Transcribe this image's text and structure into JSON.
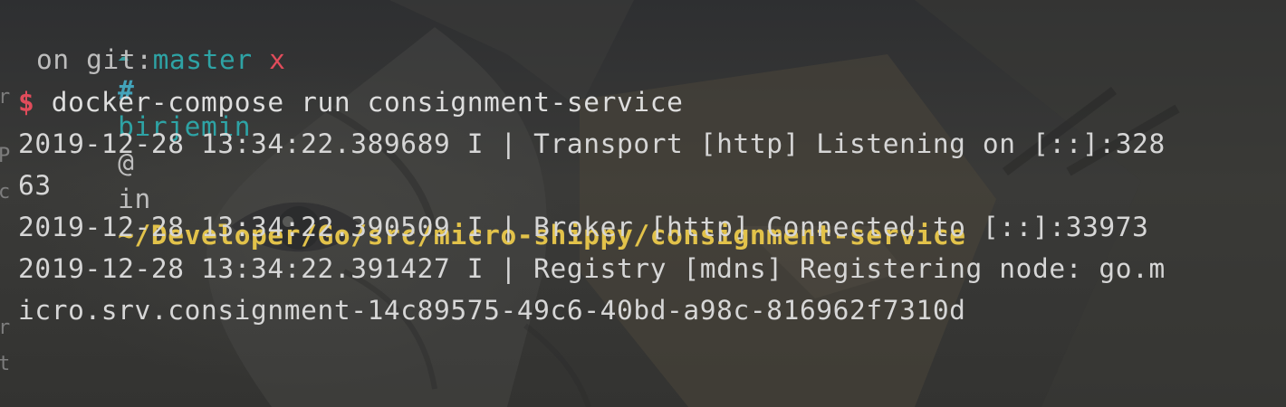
{
  "prompt": {
    "cloud_icon": "cloud-icon",
    "hash": "#",
    "user": "birjemin",
    "at": "@",
    "in": "in",
    "path": "~/Developer/Go/src/micro-shippy/consignment-service",
    "on": "on",
    "git_label": "git:",
    "branch": "master",
    "dirty_mark": "x",
    "dollar": "$",
    "command": "docker-compose run consignment-service"
  },
  "output": [
    "2019-12-28 13:34:22.389689 I | Transport [http] Listening on [::]:328",
    "63",
    "2019-12-28 13:34:22.390509 I | Broker [http] Connected to [::]:33973",
    "2019-12-28 13:34:22.391427 I | Registry [mdns] Registering node: go.m",
    "icro.srv.consignment-14c89575-49c6-40bd-a98c-816962f7310d"
  ],
  "colors": {
    "background": "#2e2f31",
    "user": "#2ea3a5",
    "path": "#e2c24a",
    "dirty": "#e14c5b",
    "dollar": "#e14c5b",
    "text": "#d6d6d6"
  }
}
